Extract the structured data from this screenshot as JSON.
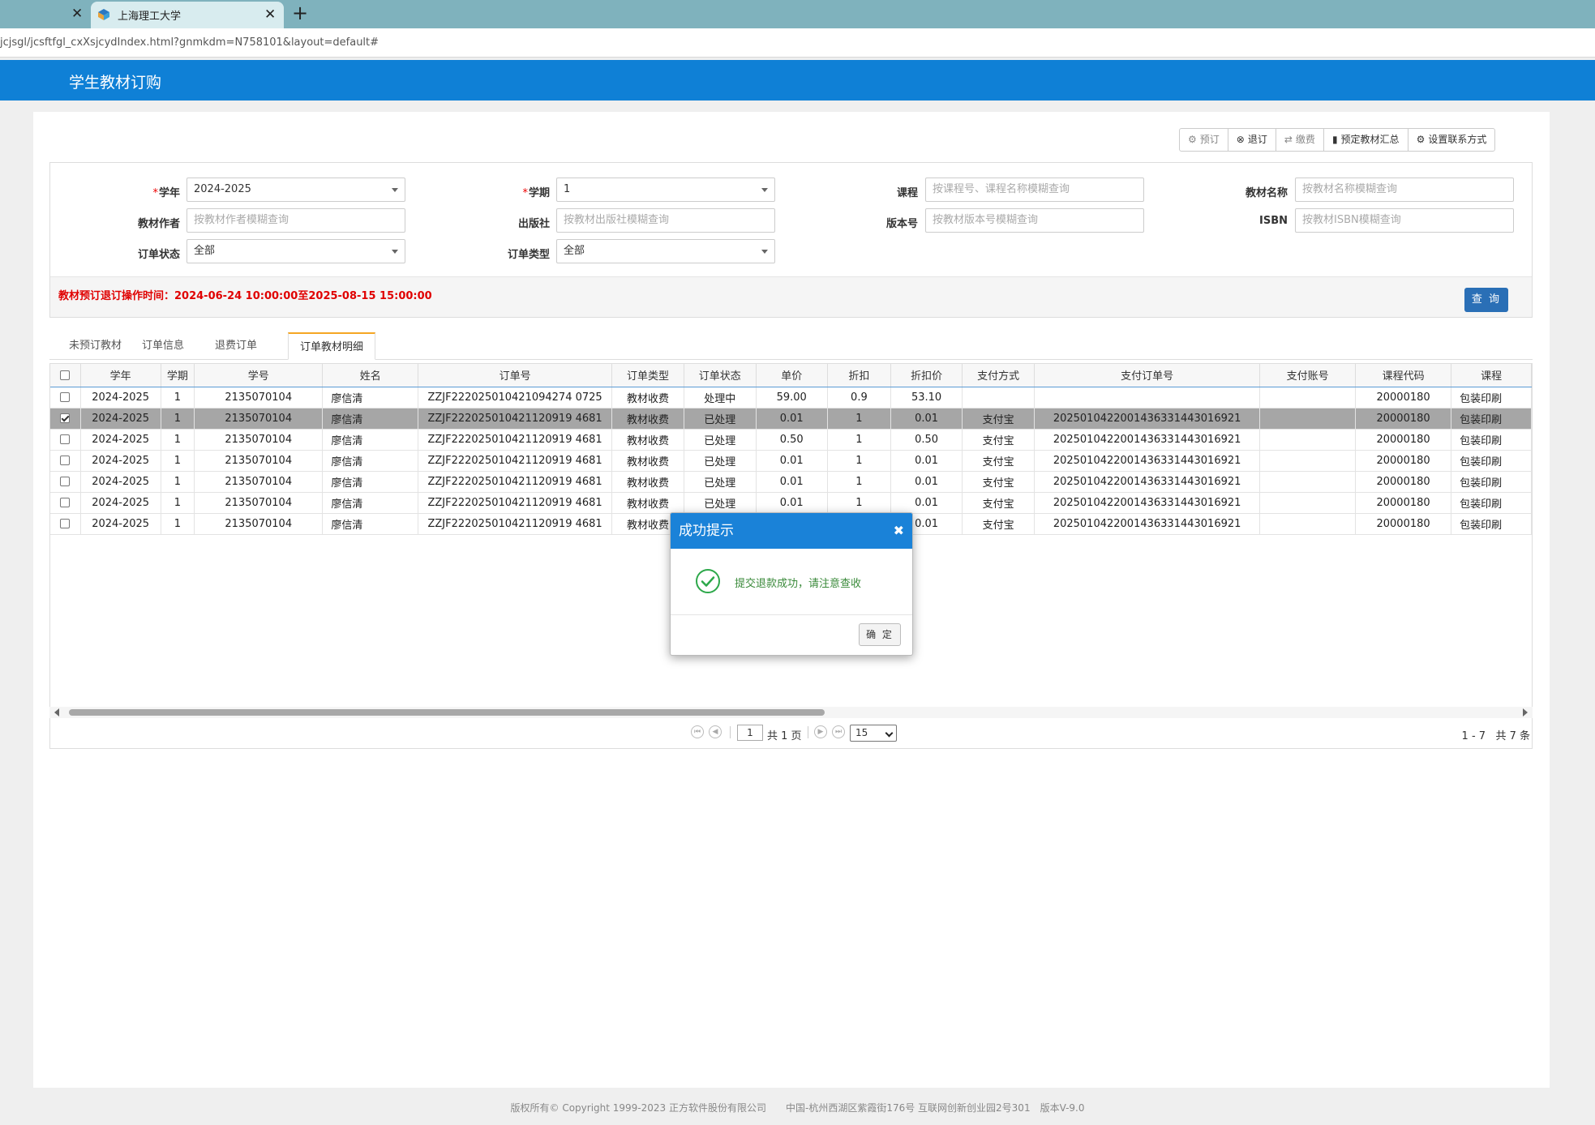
{
  "browser": {
    "active_tab_title": "上海理工大学",
    "url": "jcjsgl/jcsftfgl_cxXsjcydIndex.html?gnmkdm=N758101&layout=default#"
  },
  "app": {
    "title": "学生教材订购"
  },
  "toolbar": {
    "order": "预订",
    "cancel": "退订",
    "pay": "缴费",
    "summary": "预定教材汇总",
    "contact": "设置联系方式"
  },
  "query": {
    "year_label": "学年",
    "year_value": "2024-2025",
    "term_label": "学期",
    "term_value": "1",
    "course_label": "课程",
    "course_placeholder": "按课程号、课程名称模糊查询",
    "book_label": "教材名称",
    "book_placeholder": "按教材名称模糊查询",
    "author_label": "教材作者",
    "author_placeholder": "按教材作者模糊查询",
    "publisher_label": "出版社",
    "publisher_placeholder": "按教材出版社模糊查询",
    "edition_label": "版本号",
    "edition_placeholder": "按教材版本号模糊查询",
    "isbn_label": "ISBN",
    "isbn_placeholder": "按教材ISBN模糊查询",
    "status_label": "订单状态",
    "status_value": "全部",
    "type_label": "订单类型",
    "type_value": "全部",
    "notice": "教材预订退订操作时间：2024-06-24 10:00:00至2025-08-15 15:00:00",
    "search_button": "查 询"
  },
  "tabs": [
    "未预订教材",
    "订单信息",
    "退费订单",
    "订单教材明细"
  ],
  "table": {
    "columns": [
      "学年",
      "学期",
      "学号",
      "姓名",
      "订单号",
      "订单类型",
      "订单状态",
      "单价",
      "折扣",
      "折扣价",
      "支付方式",
      "支付订单号",
      "支付账号",
      "课程代码",
      "课程"
    ],
    "rows": [
      [
        "2024-2025",
        "1",
        "2135070104",
        "廖信清",
        "ZZJF222025010421094274 0725",
        "教材收费",
        "处理中",
        "59.00",
        "0.9",
        "53.10",
        "",
        "",
        "",
        "20000180",
        "包装印刷"
      ],
      [
        "2024-2025",
        "1",
        "2135070104",
        "廖信清",
        "ZZJF222025010421120919 4681",
        "教材收费",
        "已处理",
        "0.01",
        "1",
        "0.01",
        "支付宝",
        "2025010422001436331443016921",
        "",
        "20000180",
        "包装印刷"
      ],
      [
        "2024-2025",
        "1",
        "2135070104",
        "廖信清",
        "ZZJF222025010421120919 4681",
        "教材收费",
        "已处理",
        "0.50",
        "1",
        "0.50",
        "支付宝",
        "2025010422001436331443016921",
        "",
        "20000180",
        "包装印刷"
      ],
      [
        "2024-2025",
        "1",
        "2135070104",
        "廖信清",
        "ZZJF222025010421120919 4681",
        "教材收费",
        "已处理",
        "0.01",
        "1",
        "0.01",
        "支付宝",
        "2025010422001436331443016921",
        "",
        "20000180",
        "包装印刷"
      ],
      [
        "2024-2025",
        "1",
        "2135070104",
        "廖信清",
        "ZZJF222025010421120919 4681",
        "教材收费",
        "已处理",
        "0.01",
        "1",
        "0.01",
        "支付宝",
        "2025010422001436331443016921",
        "",
        "20000180",
        "包装印刷"
      ],
      [
        "2024-2025",
        "1",
        "2135070104",
        "廖信清",
        "ZZJF222025010421120919 4681",
        "教材收费",
        "已处理",
        "0.01",
        "1",
        "0.01",
        "支付宝",
        "2025010422001436331443016921",
        "",
        "20000180",
        "包装印刷"
      ],
      [
        "2024-2025",
        "1",
        "2135070104",
        "廖信清",
        "ZZJF222025010421120919 4681",
        "教材收费",
        "",
        "",
        "",
        "0.01",
        "支付宝",
        "2025010422001436331443016921",
        "",
        "20000180",
        "包装印刷"
      ]
    ]
  },
  "pager": {
    "page": "1",
    "total_pages_text": "共 1 页",
    "page_size": "15",
    "range": "1 - 7",
    "total": "共 7 条"
  },
  "modal": {
    "title": "成功提示",
    "message": "提交退款成功，请注意查收",
    "ok": "确 定"
  },
  "footer": "版权所有© Copyright 1999-2023 正方软件股份有限公司　　中国-杭州西湖区紫霞街176号 互联网创新创业园2号301　版本V-9.0"
}
